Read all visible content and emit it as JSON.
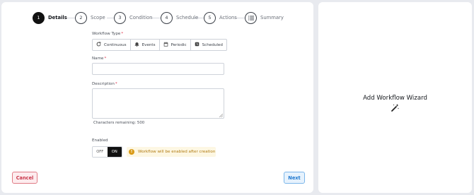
{
  "stepper": {
    "steps": [
      {
        "number": "1",
        "label": "Details",
        "active": true
      },
      {
        "number": "2",
        "label": "Scope",
        "active": false
      },
      {
        "number": "3",
        "label": "Condition",
        "active": false
      },
      {
        "number": "4",
        "label": "Schedule",
        "active": false
      },
      {
        "number": "5",
        "label": "Actions",
        "active": false
      },
      {
        "number": "",
        "label": "Summary",
        "active": false,
        "icon": "list-icon"
      }
    ]
  },
  "form": {
    "workflow_type": {
      "label": "Workflow Type",
      "required_mark": "*",
      "options": [
        {
          "label": "Continuous",
          "icon": "refresh-icon"
        },
        {
          "label": "Events",
          "icon": "bell-icon"
        },
        {
          "label": "Periodic",
          "icon": "calendar-icon"
        },
        {
          "label": "Scheduled",
          "icon": "clock-icon"
        }
      ]
    },
    "name": {
      "label": "Name",
      "required_mark": "*",
      "value": ""
    },
    "description": {
      "label": "Description",
      "required_mark": "*",
      "value": "",
      "helper": "Characters remaining: 500"
    },
    "enabled": {
      "label": "Enabled",
      "off_label": "OFF",
      "on_label": "ON",
      "selected": "ON",
      "notice": "Workflow will be enabled after creation"
    }
  },
  "buttons": {
    "cancel": "Cancel",
    "next": "Next"
  },
  "side_panel": {
    "title": "Add Workflow Wizard",
    "icon": "magic-wand-icon"
  },
  "colors": {
    "active_step": "#111111",
    "cancel_border": "#e07b85",
    "next_border": "#7bb6ea",
    "notice_bg": "#fdf7e3",
    "notice_icon": "#d99a16"
  }
}
